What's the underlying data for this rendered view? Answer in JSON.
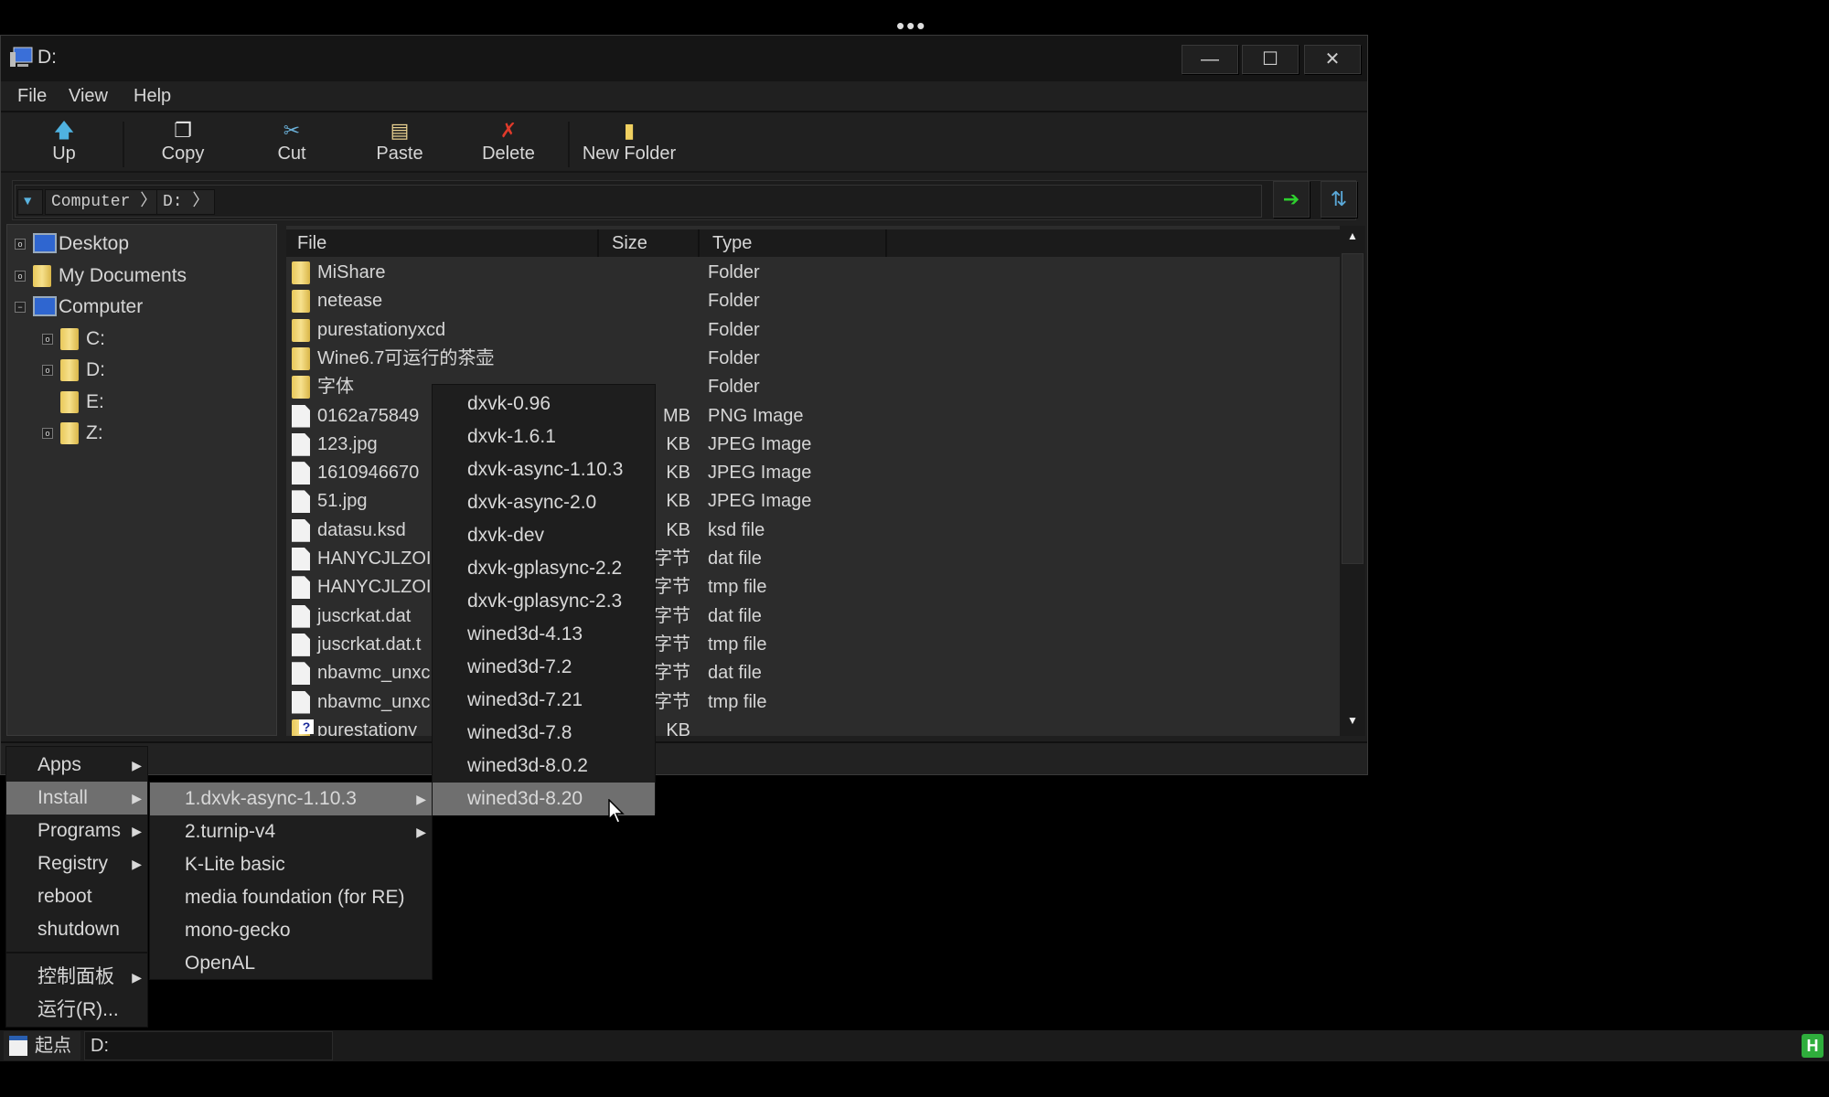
{
  "window": {
    "title": "D:",
    "controls": {
      "minimize": "—",
      "maximize": "☐",
      "close": "✕"
    }
  },
  "menubar": [
    "File",
    "View",
    "Help"
  ],
  "toolbar": [
    {
      "label": "Up",
      "icon": "up-arrow-icon",
      "glyph": "🡅",
      "color": "#4fb2e0"
    },
    {
      "label": "Copy",
      "icon": "copy-icon",
      "glyph": "❐",
      "color": "#e8e8e8"
    },
    {
      "label": "Cut",
      "icon": "scissors-icon",
      "glyph": "✂",
      "color": "#6ab0d8"
    },
    {
      "label": "Paste",
      "icon": "clipboard-icon",
      "glyph": "📋",
      "color": "#e8d090"
    },
    {
      "label": "Delete",
      "icon": "delete-x-icon",
      "glyph": "✗",
      "color": "#e03a2a"
    },
    {
      "label": "New Folder",
      "icon": "new-folder-icon",
      "glyph": "▮",
      "color": "#f0d060"
    }
  ],
  "address": {
    "dropdown": "▼",
    "crumbs": [
      "Computer",
      "D:"
    ],
    "sep": "〉",
    "go": "➔",
    "refresh": "⇅"
  },
  "tree": [
    {
      "label": "Desktop",
      "expander": "o",
      "icon": "desktop-icon"
    },
    {
      "label": "My Documents",
      "expander": "o",
      "icon": "folder-icon"
    },
    {
      "label": "Computer",
      "expander": "-",
      "icon": "computer-icon"
    },
    {
      "label": "C:",
      "expander": "o",
      "icon": "folder-icon"
    },
    {
      "label": "D:",
      "expander": "o",
      "icon": "folder-icon"
    },
    {
      "label": "E:",
      "expander": "",
      "icon": "folder-icon"
    },
    {
      "label": "Z:",
      "expander": "o",
      "icon": "folder-icon"
    }
  ],
  "columns": [
    "File",
    "Size",
    "Type"
  ],
  "files": [
    {
      "name": "MiShare",
      "size": "",
      "type": "Folder",
      "kind": "folder"
    },
    {
      "name": "netease",
      "size": "",
      "type": "Folder",
      "kind": "folder"
    },
    {
      "name": "purestationyxcd",
      "size": "",
      "type": "Folder",
      "kind": "folder"
    },
    {
      "name": "Wine6.7可运行的茶壶",
      "size": "",
      "type": "Folder",
      "kind": "folder"
    },
    {
      "name": "字体",
      "size": "",
      "type": "Folder",
      "kind": "folder"
    },
    {
      "name": "0162a75849",
      "size": "MB",
      "type": "PNG Image",
      "kind": "file"
    },
    {
      "name": "123.jpg",
      "size": "KB",
      "type": "JPEG Image",
      "kind": "file"
    },
    {
      "name": "1610946670",
      "size": "KB",
      "type": "JPEG Image",
      "kind": "file"
    },
    {
      "name": "51.jpg",
      "size": "KB",
      "type": "JPEG Image",
      "kind": "file"
    },
    {
      "name": "datasu.ksd",
      "size": "KB",
      "type": "ksd file",
      "kind": "file"
    },
    {
      "name": "HANYCJLZOI",
      "size": "字节",
      "type": "dat file",
      "kind": "file"
    },
    {
      "name": "HANYCJLZOI",
      "size": "字节",
      "type": "tmp file",
      "kind": "file"
    },
    {
      "name": "juscrkat.dat",
      "size": "字节",
      "type": "dat file",
      "kind": "file"
    },
    {
      "name": "juscrkat.dat.t",
      "size": "字节",
      "type": "tmp file",
      "kind": "file"
    },
    {
      "name": "nbavmc_unxc",
      "size": "字节",
      "type": "dat file",
      "kind": "file"
    },
    {
      "name": "nbavmc_unxc",
      "size": "字节",
      "type": "tmp file",
      "kind": "file"
    },
    {
      "name": "purestationy",
      "size": "KB",
      "type": "",
      "kind": "unknown"
    }
  ],
  "start_menu": {
    "items": [
      {
        "label": "Apps",
        "submenu": true
      },
      {
        "label": "Install",
        "submenu": true,
        "highlighted": true
      },
      {
        "label": "Programs",
        "submenu": true
      },
      {
        "label": "Registry",
        "submenu": true
      },
      {
        "label": "reboot",
        "submenu": false
      },
      {
        "label": "shutdown",
        "submenu": false
      }
    ],
    "bottom_items": [
      {
        "label": "控制面板",
        "submenu": true
      },
      {
        "label": "运行(R)...",
        "submenu": false
      }
    ]
  },
  "install_menu": [
    {
      "label": "1.dxvk-async-1.10.3",
      "submenu": true,
      "highlighted": true
    },
    {
      "label": "2.turnip-v4",
      "submenu": true
    },
    {
      "label": "K-Lite basic"
    },
    {
      "label": "media foundation (for RE)"
    },
    {
      "label": "mono-gecko"
    },
    {
      "label": "OpenAL"
    }
  ],
  "dxvk_menu": [
    "dxvk-0.96",
    "dxvk-1.6.1",
    "dxvk-async-1.10.3",
    "dxvk-async-2.0",
    "dxvk-dev",
    "dxvk-gplasync-2.2",
    "dxvk-gplasync-2.3",
    "wined3d-4.13",
    "wined3d-7.2",
    "wined3d-7.21",
    "wined3d-7.8",
    "wined3d-8.0.2",
    "wined3d-8.20"
  ],
  "dxvk_menu_highlighted": "wined3d-8.20",
  "taskbar": {
    "start": "起点",
    "task": "D:",
    "tray": "H"
  },
  "colors": {
    "highlight": "#6f6f6f",
    "menu_bg": "#1e1e1e",
    "list_bg": "#2c2c2c"
  }
}
